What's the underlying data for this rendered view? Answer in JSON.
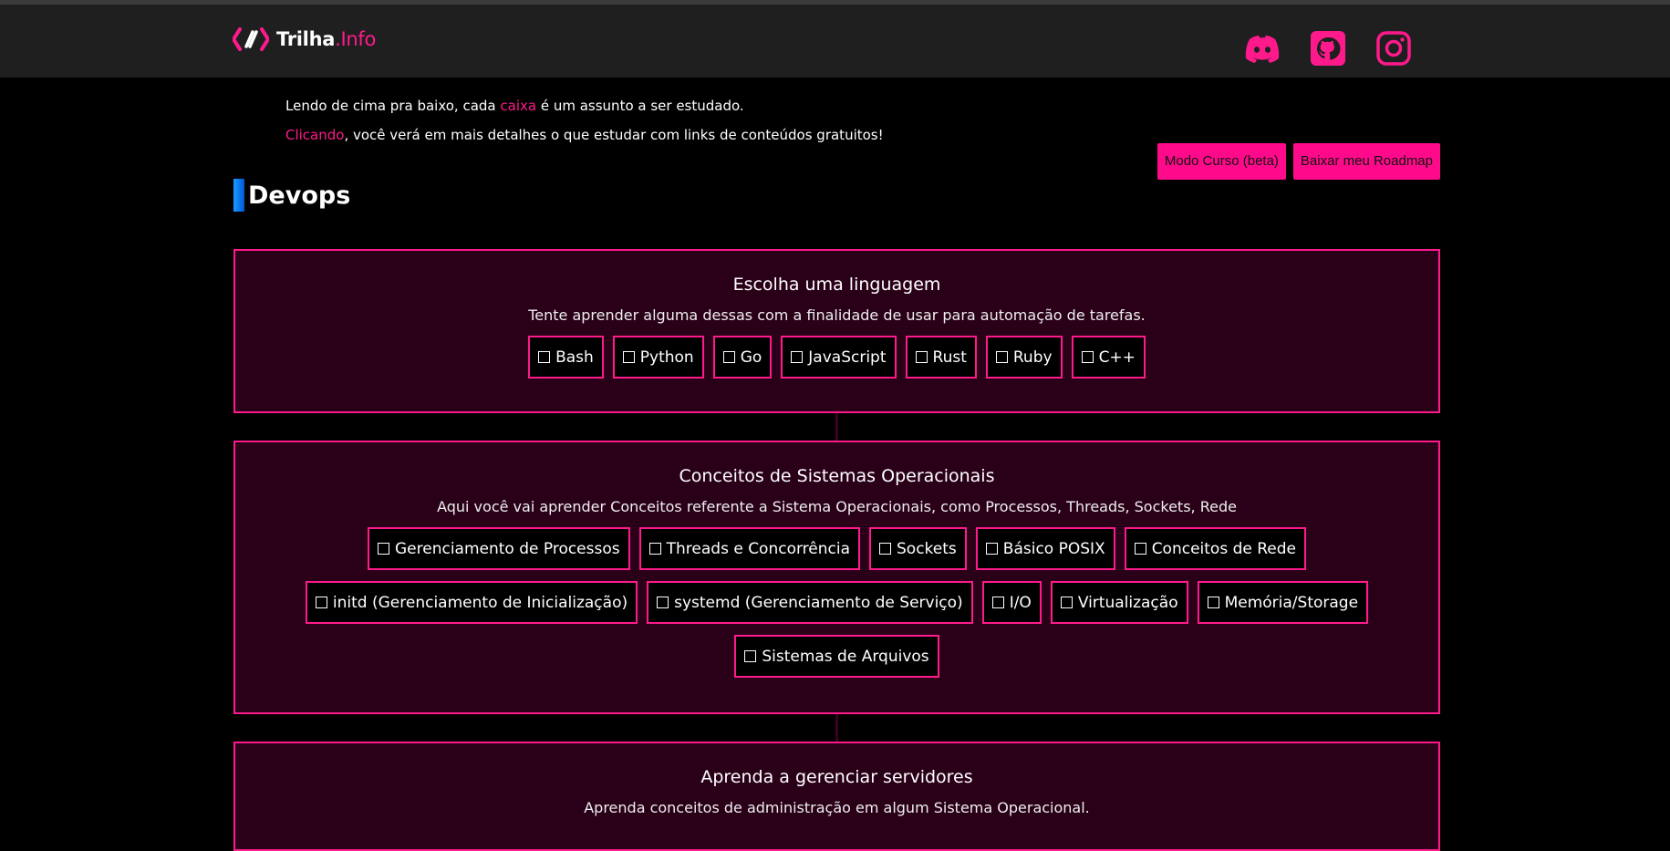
{
  "brand": {
    "name_left": "Trilha",
    "name_right": ".Info"
  },
  "social": [
    "discord-icon",
    "github-icon",
    "instagram-icon"
  ],
  "intro": {
    "line1_pre": "Lendo de cima pra baixo, cada ",
    "line1_link": "caixa",
    "line1_post": " é um assunto a ser estudado.",
    "line2_link": "Clicando",
    "line2_post": ", você verá em mais detalhes o que estudar com links de conteúdos gratuitos!"
  },
  "actions": {
    "course_mode": "Modo Curso (beta)",
    "download": "Baixar meu Roadmap"
  },
  "page_title": "Devops",
  "sections": [
    {
      "title": "Escolha uma linguagem",
      "desc": "Tente aprender alguma dessas com a finalidade de usar para automação de tarefas.",
      "chips": [
        "Bash",
        "Python",
        "Go",
        "JavaScript",
        "Rust",
        "Ruby",
        "C++"
      ]
    },
    {
      "title": "Conceitos de Sistemas Operacionais",
      "desc": "Aqui você vai aprender Conceitos referente a Sistema Operacionais, como Processos, Threads, Sockets, Rede",
      "chips": [
        "Gerenciamento de Processos",
        "Threads e Concorrência",
        "Sockets",
        "Básico POSIX",
        "Conceitos de Rede",
        "initd (Gerenciamento de Inicialização)",
        "systemd (Gerenciamento de Serviço)",
        "I/O",
        "Virtualização",
        "Memória/Storage",
        "Sistemas de Arquivos"
      ]
    },
    {
      "title": "Aprenda a gerenciar servidores",
      "desc": "Aprenda conceitos de administração em algum Sistema Operacional.",
      "chips": []
    }
  ],
  "colors": {
    "accent": "#ff1a8c",
    "section_bg": "#2a0018",
    "header_bg": "#1f1f1f"
  }
}
